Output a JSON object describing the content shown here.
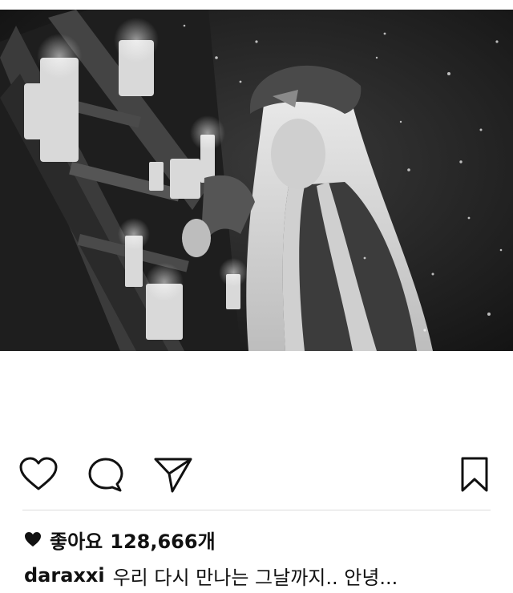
{
  "post": {
    "photo_alt": "",
    "likes": {
      "label": "좋아요",
      "count": "128,666개"
    },
    "caption": {
      "username": "daraxxi",
      "text": "우리 다시 만나는 그날까지.. 안녕..."
    }
  },
  "actions": {
    "like_icon": "heart-outline-icon",
    "comment_icon": "comment-bubble-icon",
    "share_icon": "paper-plane-icon",
    "save_icon": "bookmark-outline-icon"
  },
  "colors": {
    "text": "#111111",
    "divider": "#dbdbdb",
    "background": "#ffffff"
  }
}
